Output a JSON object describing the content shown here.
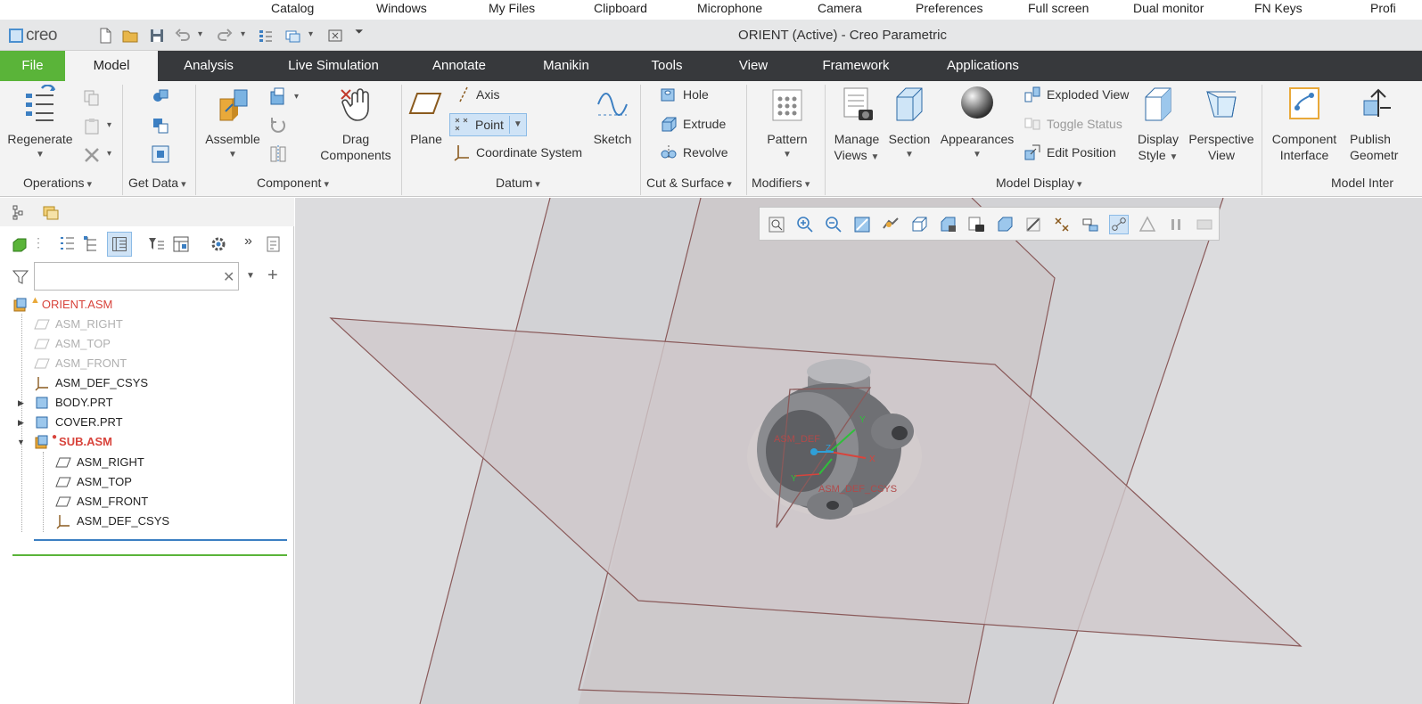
{
  "remote_bar": {
    "items": [
      "Catalog",
      "Windows",
      "My Files",
      "Clipboard",
      "Microphone",
      "Camera",
      "Preferences",
      "Full screen",
      "Dual monitor",
      "FN Keys",
      "Profi"
    ]
  },
  "app": {
    "logo_text": "creo",
    "window_title": "ORIENT (Active) - Creo Parametric"
  },
  "tabs": [
    "File",
    "Model",
    "Analysis",
    "Live Simulation",
    "Annotate",
    "Manikin",
    "Tools",
    "View",
    "Framework",
    "Applications"
  ],
  "active_tab": "Model",
  "ribbon": {
    "operations": {
      "regenerate": "Regenerate",
      "group": "Operations"
    },
    "get_data": {
      "group": "Get Data"
    },
    "component": {
      "assemble": "Assemble",
      "drag": "Drag Components",
      "group": "Component"
    },
    "datum": {
      "plane": "Plane",
      "axis": "Axis",
      "point": "Point",
      "csys": "Coordinate System",
      "sketch": "Sketch",
      "group": "Datum"
    },
    "cut_surface": {
      "hole": "Hole",
      "extrude": "Extrude",
      "revolve": "Revolve",
      "group": "Cut & Surface"
    },
    "modifiers": {
      "pattern": "Pattern",
      "group": "Modifiers"
    },
    "model_display": {
      "manage_views": "Manage Views",
      "section": "Section",
      "appearances": "Appearances",
      "exploded_view": "Exploded View",
      "toggle_status": "Toggle Status",
      "edit_position": "Edit Position",
      "display_style": "Display Style",
      "perspective_view": "Perspective View",
      "group": "Model Display"
    },
    "model_intent": {
      "component_interface": "Component Interface",
      "publish_geometry": "Publish Geometr",
      "group": "Model Inter"
    }
  },
  "tree": {
    "filter_placeholder": "",
    "items": [
      {
        "label": "ORIENT.ASM",
        "style": "warn"
      },
      {
        "label": "ASM_RIGHT",
        "style": "dim"
      },
      {
        "label": "ASM_TOP",
        "style": "dim"
      },
      {
        "label": "ASM_FRONT",
        "style": "dim"
      },
      {
        "label": "ASM_DEF_CSYS",
        "style": "normal"
      },
      {
        "label": "BODY.PRT",
        "style": "normal"
      },
      {
        "label": "COVER.PRT",
        "style": "normal"
      },
      {
        "label": "SUB.ASM",
        "style": "err"
      },
      {
        "label": "ASM_RIGHT",
        "style": "normal"
      },
      {
        "label": "ASM_TOP",
        "style": "normal"
      },
      {
        "label": "ASM_FRONT",
        "style": "normal"
      },
      {
        "label": "ASM_DEF_CSYS",
        "style": "normal"
      }
    ]
  },
  "graphics": {
    "csys_label_1": "ASM_DEF",
    "csys_label_2": "ASM_DEF_CSYS",
    "axis_x": "X",
    "axis_y": "Y",
    "axis_z": "Z"
  },
  "colors": {
    "file_tab": "#5ab439",
    "tab_bar": "#37393c",
    "plane_edge": "#8a5a5a",
    "error_red": "#d8443c"
  }
}
